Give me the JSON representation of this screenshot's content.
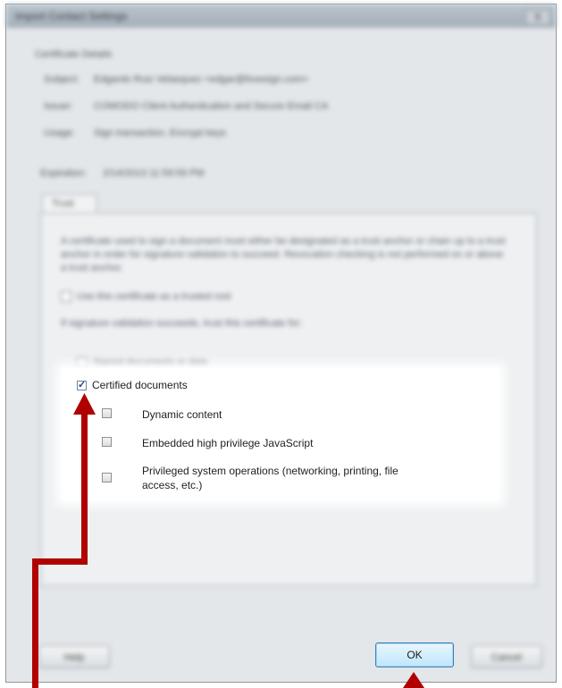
{
  "dialog": {
    "title": "Import Contact Settings",
    "close_label": "X",
    "cert_details_heading": "Certificate Details",
    "subject_label": "Subject:",
    "subject_value": "Edgardo Ruiz Velasquez <edgar@foxesign.com>",
    "issuer_label": "Issuer:",
    "issuer_value": "COMODO Client Authentication and Secure Email CA",
    "usage_label": "Usage:",
    "usage_value": "Sign transaction, Encrypt keys",
    "expiration_label": "Expiration:",
    "expiration_value": "2/14/2013 11:59:59 PM"
  },
  "tab": {
    "label": "Trust",
    "description": "A certificate used to sign a document must either be designated as a trust anchor or chain up to a trust anchor in order for signature validation to succeed. Revocation checking is not performed on or above a trust anchor.",
    "trusted_root_label": "Use this certificate as a trusted root",
    "trust_for_label": "If signature validation succeeds, trust this certificate for:",
    "signed_docs_label": "Signed documents or data"
  },
  "options": {
    "certified_documents": "Certified documents",
    "dynamic_content": "Dynamic content",
    "embedded_js": "Embedded high privilege JavaScript",
    "privileged_ops_line1": "Privileged system operations (networking, printing, file",
    "privileged_ops_line2": "access, etc.)"
  },
  "buttons": {
    "help": "Help",
    "ok": "OK",
    "cancel": "Cancel"
  },
  "colors": {
    "annotation_arrow": "#b00000",
    "ok_border": "#3c7fb1"
  }
}
